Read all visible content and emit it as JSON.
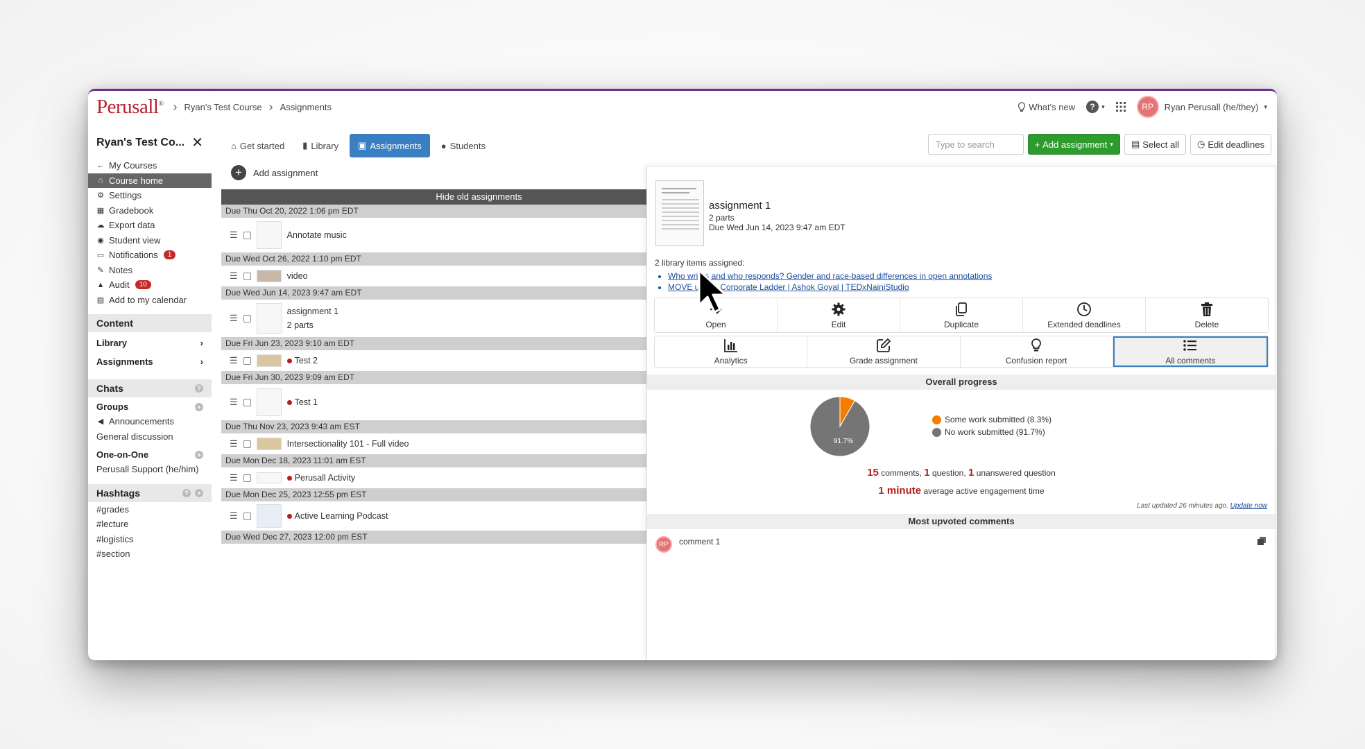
{
  "app": {
    "logo": "Perusall",
    "logo_mark": "®",
    "breadcrumbs": [
      "Ryan's Test Course",
      "Assignments"
    ],
    "whats_new": "What's new",
    "help": "?",
    "user": {
      "initials": "RP",
      "name": "Ryan Perusall (he/they)"
    }
  },
  "sidebar": {
    "course_title": "Ryan's Test Co...",
    "items": [
      {
        "label": "My Courses",
        "icon": "arrow-left-icon"
      },
      {
        "label": "Course home",
        "icon": "home-icon",
        "active": true
      },
      {
        "label": "Settings",
        "icon": "gear-icon"
      },
      {
        "label": "Gradebook",
        "icon": "table-icon"
      },
      {
        "label": "Export data",
        "icon": "cloud-icon"
      },
      {
        "label": "Student view",
        "icon": "eye-icon"
      },
      {
        "label": "Notifications",
        "icon": "inbox-icon",
        "badge": "1"
      },
      {
        "label": "Notes",
        "icon": "pencil-icon"
      },
      {
        "label": "Audit",
        "icon": "warning-icon",
        "badge": "10"
      },
      {
        "label": "Add to my calendar",
        "icon": "calendar-icon"
      }
    ],
    "content_label": "Content",
    "library_label": "Library",
    "assignments_label": "Assignments",
    "chats_label": "Chats",
    "groups_label": "Groups",
    "groups_items": [
      "Announcements",
      "General discussion"
    ],
    "one_on_one_label": "One-on-One",
    "one_on_one_items": [
      "Perusall Support (he/him)"
    ],
    "hashtags_label": "Hashtags",
    "hashtags": [
      "#grades",
      "#lecture",
      "#logistics",
      "#section"
    ]
  },
  "tabs": [
    "Get started",
    "Library",
    "Assignments",
    "Students"
  ],
  "toolbar": {
    "search_placeholder": "Type to search",
    "add_assignment": "Add assignment",
    "select_all": "Select all",
    "edit_deadlines": "Edit deadlines"
  },
  "list": {
    "add_label": "Add assignment",
    "hide_old": "Hide old assignments",
    "groups": [
      {
        "due": "Due Thu Oct 20, 2022 1:06 pm EDT",
        "title": "Annotate music",
        "sub": "",
        "dot": false
      },
      {
        "due": "Due Wed Oct 26, 2022 1:10 pm EDT",
        "title": "video",
        "sub": "",
        "dot": false
      },
      {
        "due": "Due Wed Jun 14, 2023 9:47 am EDT",
        "title": "assignment 1",
        "sub": "2 parts",
        "dot": false
      },
      {
        "due": "Due Fri Jun 23, 2023 9:10 am EDT",
        "title": "Test 2",
        "sub": "",
        "dot": true
      },
      {
        "due": "Due Fri Jun 30, 2023 9:09 am EDT",
        "title": "Test 1",
        "sub": "",
        "dot": true
      },
      {
        "due": "Due Thu Nov 23, 2023 9:43 am EST",
        "title": "Intersectionality 101 - Full video",
        "sub": "",
        "dot": false
      },
      {
        "due": "Due Mon Dec 18, 2023 11:01 am EST",
        "title": "Perusall Activity",
        "sub": "",
        "dot": true
      },
      {
        "due": "Due Mon Dec 25, 2023 12:55 pm EST",
        "title": "Active Learning Podcast",
        "sub": "",
        "dot": true
      },
      {
        "due": "Due Wed Dec 27, 2023 12:00 pm EST",
        "title": "",
        "sub": "",
        "dot": false
      }
    ]
  },
  "panel": {
    "title": "assignment 1",
    "parts": "2 parts",
    "due": "Due Wed Jun 14, 2023 9:47 am EDT",
    "library_text": "2 library items assigned:",
    "links": [
      "Who writes and who responds? Gender and race-based differences in open annotations",
      "MOVE up the Corporate Ladder | Ashok Goyal | TEDxNainiStudio"
    ],
    "actions1": [
      "Open",
      "Edit",
      "Duplicate",
      "Extended deadlines",
      "Delete"
    ],
    "actions2": [
      "Analytics",
      "Grade assignment",
      "Confusion report",
      "All comments"
    ],
    "overall_progress": "Overall progress",
    "pie_label": "91.7%",
    "legend": [
      "Some work submitted (8.3%)",
      "No work submitted (91.7%)"
    ],
    "stats": {
      "comments": "15",
      "comments_label": "comments,",
      "questions": "1",
      "questions_label": "question,",
      "unanswered": "1",
      "unanswered_label": "unanswered question"
    },
    "engagement": {
      "value": "1 minute",
      "label": "average active engagement time"
    },
    "last_updated": "Last updated 26 minutes ago.",
    "update_now": "Update now",
    "most_upvoted": "Most upvoted comments",
    "comment": {
      "initials": "RP",
      "text": "comment 1"
    }
  },
  "colors": {
    "brand": "#b6202e",
    "accent": "#3a7fc1",
    "green": "#2e9b2e",
    "pie_some": "#f57c00",
    "pie_none": "#757575"
  },
  "chart_data": {
    "type": "pie",
    "categories": [
      "Some work submitted",
      "No work submitted"
    ],
    "values": [
      8.3,
      91.7
    ],
    "title": "Overall progress"
  }
}
